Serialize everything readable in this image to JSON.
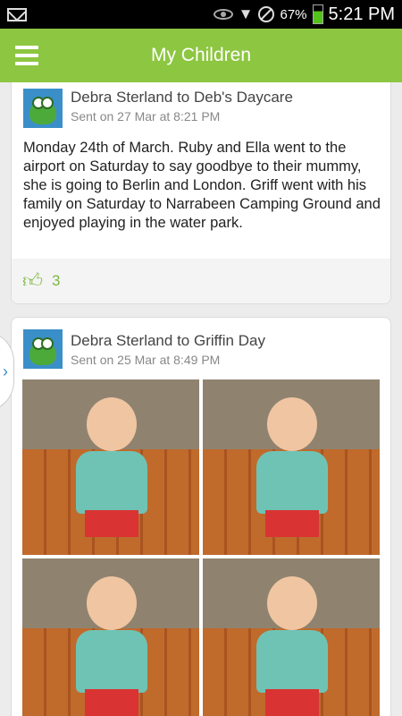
{
  "status_bar": {
    "battery": "67%",
    "time": "5:21 PM"
  },
  "app_bar": {
    "title": "My Children"
  },
  "posts": [
    {
      "from": "Debra Sterland to Deb's Daycare",
      "sent": "Sent on 27 Mar at 8:21 PM",
      "body": "Monday 24th of March.  Ruby and Ella went to the airport on Saturday to say goodbye to their mummy, she is going to Berlin and  London. Griff went with his family on Saturday to Narrabeen Camping Ground and enjoyed playing in the water park.",
      "likes": "3"
    },
    {
      "from": "Debra Sterland to Griffin Day",
      "sent": "Sent on 25 Mar at 8:49 PM"
    }
  ],
  "colors": {
    "accent": "#8dc641",
    "like": "#7cb842"
  }
}
